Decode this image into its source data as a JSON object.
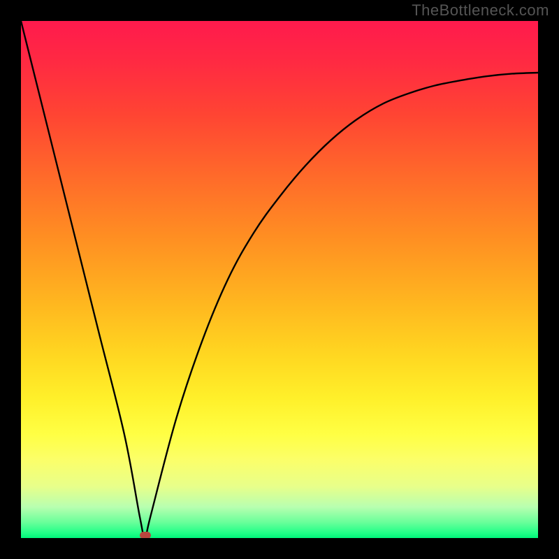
{
  "watermark": "TheBottleneck.com",
  "chart_data": {
    "type": "line",
    "title": "",
    "xlabel": "",
    "ylabel": "",
    "xlim": [
      0,
      100
    ],
    "ylim": [
      0,
      100
    ],
    "grid": false,
    "legend": false,
    "series": [
      {
        "name": "bottleneck-curve",
        "x": [
          0,
          5,
          10,
          15,
          20,
          23,
          24,
          25,
          30,
          35,
          40,
          45,
          50,
          55,
          60,
          65,
          70,
          75,
          80,
          85,
          90,
          95,
          100
        ],
        "values": [
          100,
          80,
          60,
          40,
          20,
          4,
          0,
          4,
          23,
          38,
          50,
          59,
          66,
          72,
          77,
          81,
          84,
          86,
          87.5,
          88.5,
          89.3,
          89.8,
          90
        ]
      }
    ],
    "annotations": [
      {
        "name": "min-marker",
        "x": 24,
        "y": 0,
        "shape": "rounded-rect",
        "color": "#b8463e"
      }
    ],
    "background_gradient": {
      "direction": "top-to-bottom",
      "stops": [
        {
          "pos": 0.0,
          "color": "#ff1a4d"
        },
        {
          "pos": 0.3,
          "color": "#ff6a2a"
        },
        {
          "pos": 0.6,
          "color": "#ffd821"
        },
        {
          "pos": 0.8,
          "color": "#ffff44"
        },
        {
          "pos": 0.95,
          "color": "#b8ffb0"
        },
        {
          "pos": 1.0,
          "color": "#00f57a"
        }
      ]
    }
  }
}
